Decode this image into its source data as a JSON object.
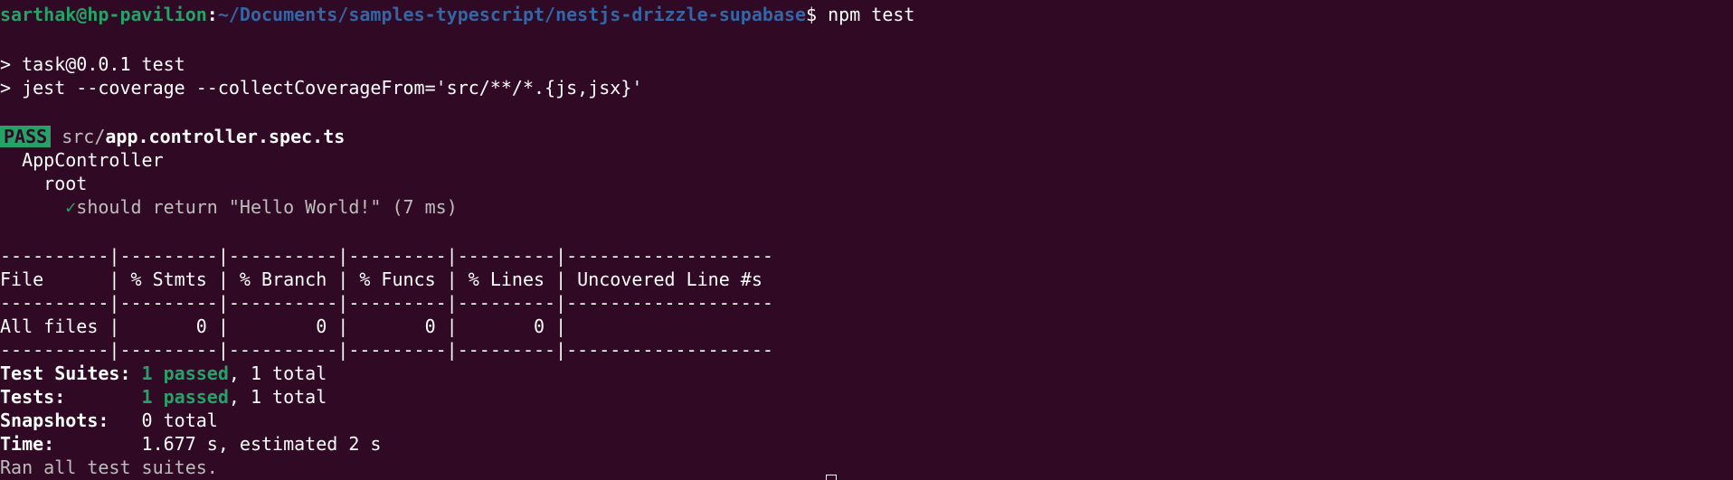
{
  "terminal": {
    "bg": "#300a24",
    "prompt": {
      "user_host": "sarthak@hp-pavilion",
      "colon": ":",
      "path": "~/Documents/samples-typescript/nestjs-drizzle-supabase",
      "symbol": "$",
      "command": " npm test"
    },
    "script_lines": [
      "> task@0.0.1 test",
      "> jest --coverage --collectCoverageFrom='src/**/*.{js,jsx}'"
    ],
    "pass_badge": "PASS",
    "spec_dir": "src/",
    "spec_file": "app.controller.spec.ts",
    "suite": "AppController",
    "describe": "root",
    "check_mark": "✓",
    "test_name": "should return \"Hello World!\" (7 ms)",
    "coverage_table": [
      "----------|---------|----------|---------|---------|-------------------",
      "File      | % Stmts | % Branch | % Funcs | % Lines | Uncovered Line #s",
      "----------|---------|----------|---------|---------|-------------------",
      "All files |       0 |        0 |       0 |       0 |",
      "----------|---------|----------|---------|---------|-------------------"
    ],
    "summary": {
      "suites_label": "Test Suites: ",
      "suites_passed": "1 passed",
      "suites_total": ", 1 total",
      "tests_label": "Tests:       ",
      "tests_passed": "1 passed",
      "tests_total": ", 1 total",
      "snapshots_label": "Snapshots:   ",
      "snapshots_value": "0 total",
      "time_label": "Time:        ",
      "time_value": "1.677 s, estimated 2 s",
      "ran_all": "Ran all test suites."
    }
  }
}
